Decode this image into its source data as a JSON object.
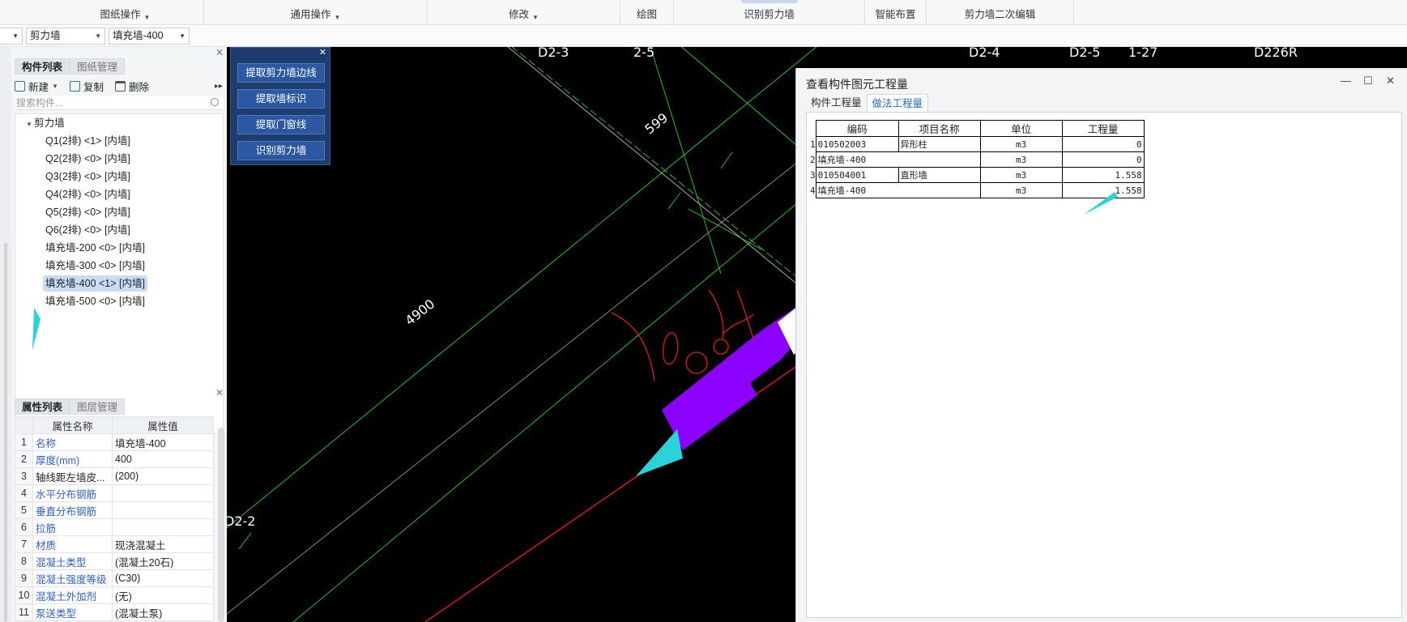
{
  "ribbon": {
    "groups": [
      {
        "label": "图纸操作",
        "has_menu": true
      },
      {
        "label": "通用操作",
        "has_menu": true
      },
      {
        "label": "修改",
        "has_menu": true
      },
      {
        "label": "绘图",
        "has_menu": false
      },
      {
        "label": "识别剪力墙",
        "has_menu": false
      },
      {
        "label": "智能布置",
        "has_menu": false
      },
      {
        "label": "剪力墙二次编辑",
        "has_menu": false
      }
    ]
  },
  "combos": {
    "floor": "",
    "category": "剪力墙",
    "component": "填充墙-400"
  },
  "component_panel": {
    "tabs": [
      "构件列表",
      "图纸管理"
    ],
    "toolbar": {
      "new": "新建",
      "copy": "复制",
      "delete": "删除"
    },
    "search_placeholder": "搜索构件...",
    "group": "剪力墙",
    "items": [
      "Q1(2排) <1> [内墙]",
      "Q2(2排) <0> [内墙]",
      "Q3(2排) <0> [内墙]",
      "Q4(2排) <0> [内墙]",
      "Q5(2排) <0> [内墙]",
      "Q6(2排) <0> [内墙]",
      "填充墙-200 <0> [内墙]",
      "填充墙-300 <0> [内墙]",
      "填充墙-400 <1> [内墙]",
      "填充墙-500 <0> [内墙]"
    ],
    "selected_index": 8
  },
  "property_panel": {
    "tabs": [
      "属性列表",
      "图层管理"
    ],
    "headers": [
      "属性名称",
      "属性值"
    ],
    "rows": [
      {
        "n": "1",
        "k": "名称",
        "v": "填充墙-400",
        "blue": true
      },
      {
        "n": "2",
        "k": "厚度(mm)",
        "v": "400",
        "blue": true
      },
      {
        "n": "3",
        "k": "轴线距左墙皮...",
        "v": "(200)",
        "blue": false
      },
      {
        "n": "4",
        "k": "水平分布钢筋",
        "v": "",
        "blue": true
      },
      {
        "n": "5",
        "k": "垂直分布钢筋",
        "v": "",
        "blue": true
      },
      {
        "n": "6",
        "k": "拉筋",
        "v": "",
        "blue": true
      },
      {
        "n": "7",
        "k": "材质",
        "v": "现浇混凝土",
        "blue": true
      },
      {
        "n": "8",
        "k": "混凝土类型",
        "v": "(混凝土20石)",
        "blue": true
      },
      {
        "n": "9",
        "k": "混凝土强度等级",
        "v": "(C30)",
        "blue": true
      },
      {
        "n": "10",
        "k": "混凝土外加剂",
        "v": "(无)",
        "blue": true
      },
      {
        "n": "11",
        "k": "泵送类型",
        "v": "(混凝土泵)",
        "blue": true
      }
    ]
  },
  "command_panel": {
    "buttons": [
      "提取剪力墙边线",
      "提取墙标识",
      "提取门窗线",
      "识别剪力墙"
    ]
  },
  "cad": {
    "axis_labels": [
      "D2-3",
      "2-5",
      "D2-4",
      "D2-5",
      "1-27",
      "D226R",
      "D2-2"
    ],
    "dimensions": [
      "599",
      "4900"
    ]
  },
  "dialog": {
    "title": "查看构件图元工程量",
    "tabs": [
      "构件工程量",
      "做法工程量"
    ],
    "active_tab": 1,
    "headers": [
      "编码",
      "项目名称",
      "单位",
      "工程量"
    ],
    "rows": [
      {
        "n": "1",
        "code": "010502003",
        "name": "异形柱",
        "unit": "m3",
        "qty": "0"
      },
      {
        "n": "2",
        "code": "填充墙-400",
        "name": "",
        "unit": "m3",
        "qty": "0"
      },
      {
        "n": "3",
        "code": "010504001",
        "name": "直形墙",
        "unit": "m3",
        "qty": "1.558"
      },
      {
        "n": "4",
        "code": "填充墙-400",
        "name": "",
        "unit": "m3",
        "qty": "1.558"
      }
    ]
  },
  "colors": {
    "accent": "#2a6ac8",
    "wall": "#8b00ff",
    "annotation": "#2bd3d8"
  }
}
